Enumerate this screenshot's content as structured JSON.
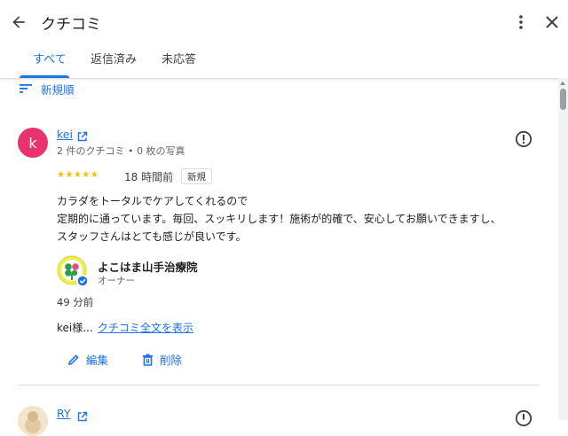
{
  "header": {
    "title": "クチコミ",
    "tabs": [
      {
        "label": "すべて",
        "active": true
      },
      {
        "label": "返信済み",
        "active": false
      },
      {
        "label": "未応答",
        "active": false
      }
    ]
  },
  "sort": {
    "label": "新規順"
  },
  "reviews": [
    {
      "avatar_letter": "k",
      "avatar_color": "#e8336e",
      "name": "kei",
      "meta": "2 件のクチコミ • 0 枚の写真",
      "stars": "★★★★★",
      "time": "18 時間前",
      "badge": "新規",
      "text": "カラダをトータルでケアしてくれるので\n定期的に通っています。毎回、スッキリします！施術が的確で、安心してお願いできますし、\nスタッフさんはとても感じが良いです。",
      "reply": {
        "owner_name": "よこはま山手治療院",
        "owner_role": "オーナー",
        "time": "49 分前",
        "snippet": "kei様...",
        "link": "クチコミ全文を表示"
      },
      "actions": {
        "edit": "編集",
        "delete": "削除"
      }
    },
    {
      "name": "RY"
    }
  ],
  "colors": {
    "accent": "#1a73e8",
    "star": "#fbbc04",
    "avatar": "#e8336e"
  }
}
